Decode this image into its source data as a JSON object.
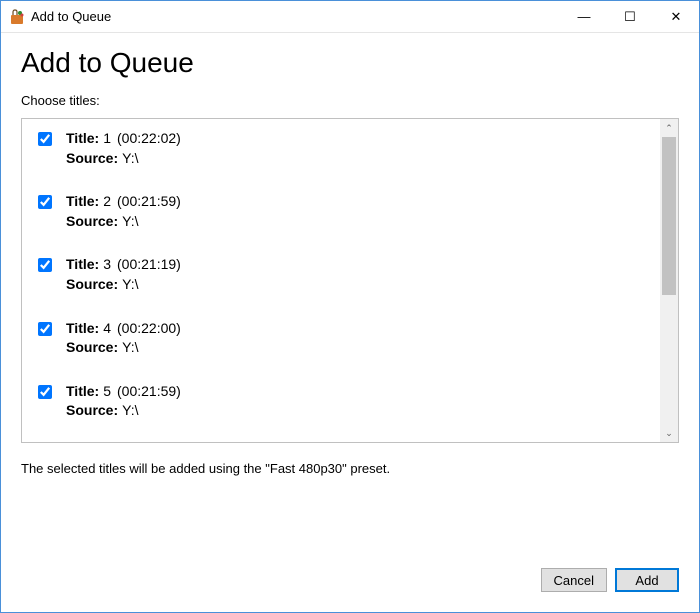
{
  "window": {
    "title": "Add to Queue"
  },
  "dialog": {
    "heading": "Add to Queue",
    "choose_label": "Choose titles:",
    "labels": {
      "title": "Title:",
      "source": "Source:"
    },
    "footer_text": "The selected titles will be added using the  \"Fast 480p30\"  preset."
  },
  "buttons": {
    "cancel": "Cancel",
    "add": "Add"
  },
  "items": [
    {
      "checked": true,
      "number": "1",
      "duration": "(00:22:02)",
      "source": "Y:\\"
    },
    {
      "checked": true,
      "number": "2",
      "duration": "(00:21:59)",
      "source": "Y:\\"
    },
    {
      "checked": true,
      "number": "3",
      "duration": "(00:21:19)",
      "source": "Y:\\"
    },
    {
      "checked": true,
      "number": "4",
      "duration": "(00:22:00)",
      "source": "Y:\\"
    },
    {
      "checked": true,
      "number": "5",
      "duration": "(00:21:59)",
      "source": "Y:\\"
    }
  ],
  "icons": {
    "minimize": "—",
    "maximize": "☐",
    "close": "✕",
    "up": "⌃",
    "down": "⌄"
  }
}
